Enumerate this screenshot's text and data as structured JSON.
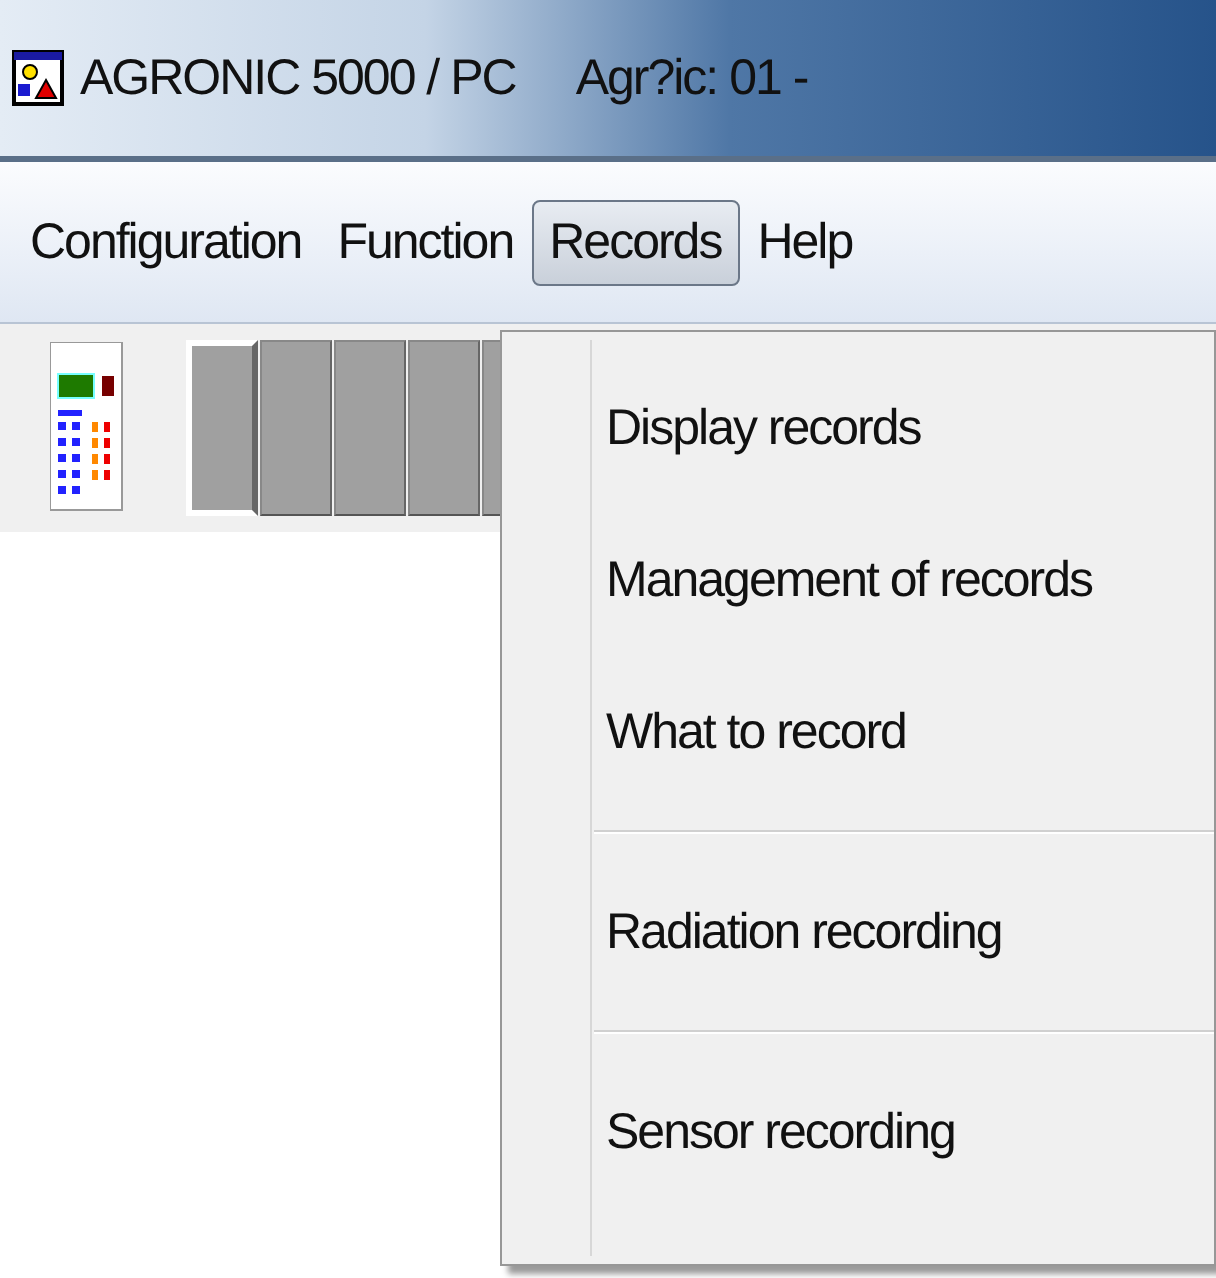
{
  "window": {
    "title": "AGRONIC 5000 / PC",
    "subtitle": "Agr?ic: 01 -"
  },
  "menu_bar": [
    {
      "label": "Configuration",
      "selected": false
    },
    {
      "label": "Function",
      "selected": false
    },
    {
      "label": "Records",
      "selected": true
    },
    {
      "label": "Help",
      "selected": false
    }
  ],
  "toolbar": {
    "buttons": [
      {
        "pressed": true
      },
      {
        "pressed": false
      },
      {
        "pressed": false
      },
      {
        "pressed": false
      },
      {
        "pressed": false
      }
    ]
  },
  "dropdown": [
    {
      "kind": "item",
      "label": "Display records"
    },
    {
      "kind": "item",
      "label": "Management of records"
    },
    {
      "kind": "item",
      "label": "What to record"
    },
    {
      "kind": "separator"
    },
    {
      "kind": "item",
      "label": "Radiation recording"
    },
    {
      "kind": "separator"
    },
    {
      "kind": "item",
      "label": "Sensor recording"
    }
  ]
}
